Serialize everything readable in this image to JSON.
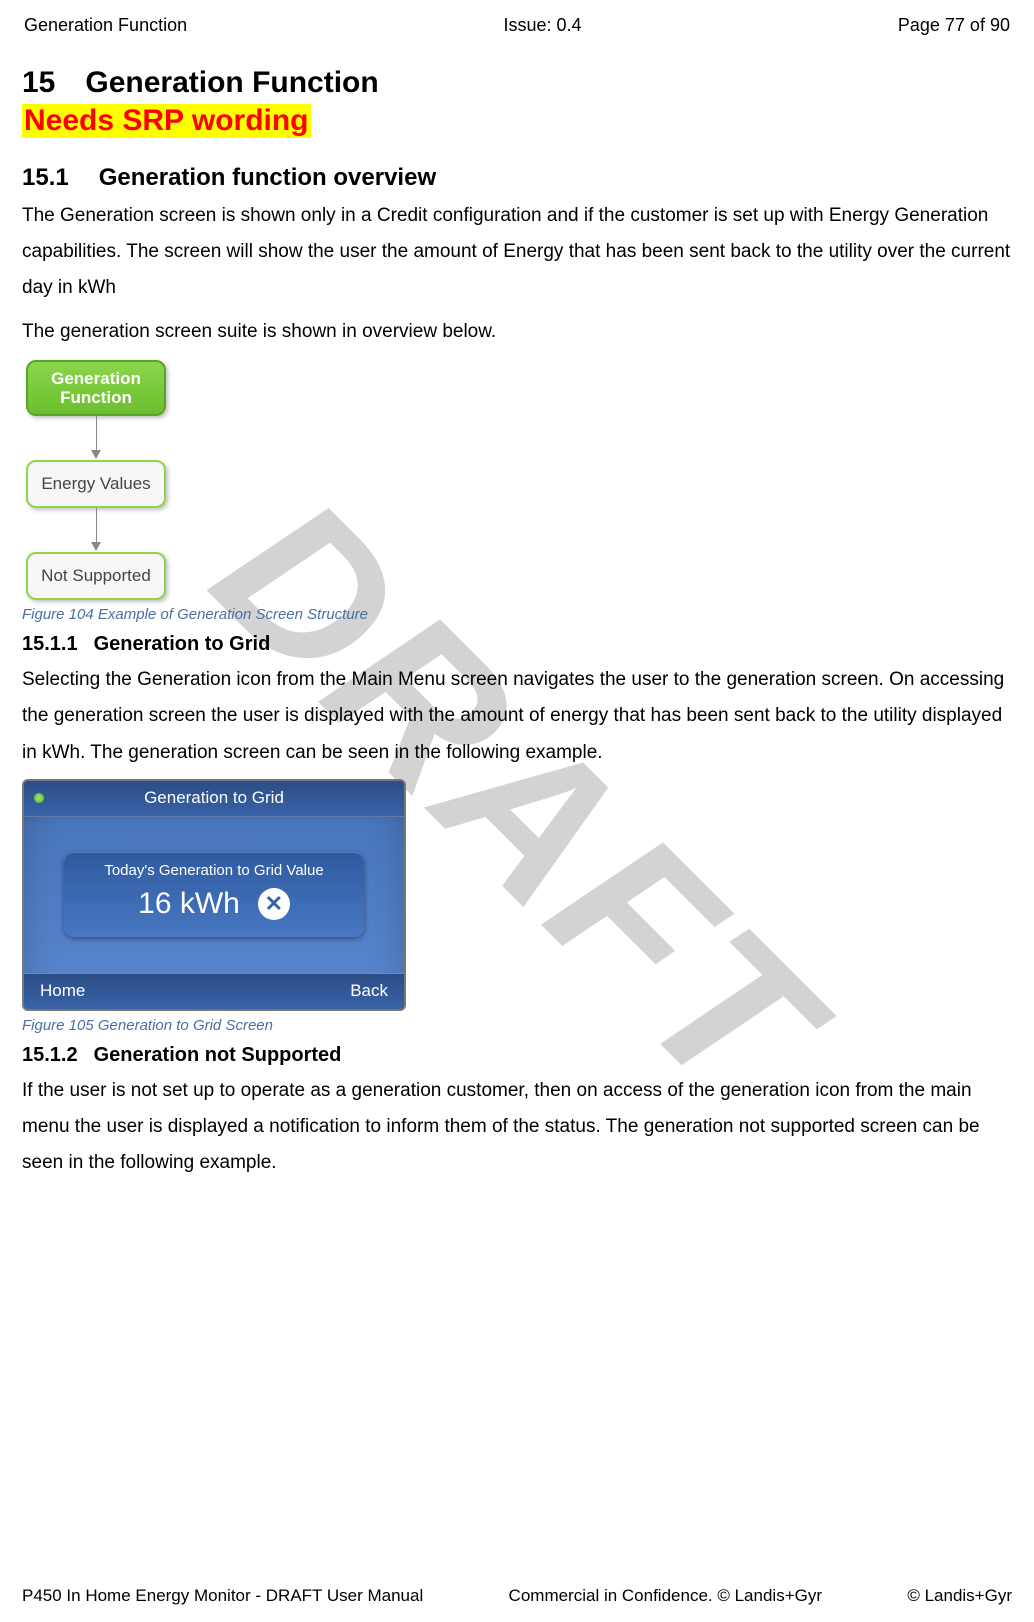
{
  "header": {
    "left": "Generation Function",
    "center": "Issue: 0.4",
    "right": "Page 77 of 90"
  },
  "watermark": "DRAFT",
  "section": {
    "number": "15",
    "title": "Generation Function",
    "highlight": "Needs SRP wording"
  },
  "sub1": {
    "number": "15.1",
    "title": "Generation function overview",
    "para1": "The Generation screen is shown only in a Credit configuration and if the customer is set up with Energy Generation capabilities. The screen will show the user the amount of Energy that has been sent back to the utility over the current day in kWh",
    "para2": "The generation screen suite is shown in overview below."
  },
  "flowchart": {
    "node1": "Generation Function",
    "node2": "Energy Values",
    "node3": "Not Supported"
  },
  "caption1": "Figure 104 Example of Generation Screen Structure",
  "sub11": {
    "number": "15.1.1",
    "title": "Generation to Grid",
    "para": "Selecting the Generation icon from the Main Menu screen navigates the user to the generation screen. On accessing the generation screen the user is displayed with the amount of energy that has been sent back to the utility displayed in kWh. The generation screen can be seen in the following example."
  },
  "device": {
    "title": "Generation to Grid",
    "panel_label": "Today's Generation to Grid Value",
    "value": "16 kWh",
    "check": "✕",
    "home": "Home",
    "back": "Back"
  },
  "caption2": "Figure 105 Generation to Grid Screen",
  "sub12": {
    "number": "15.1.2",
    "title": "Generation not Supported",
    "para": "If the user is not set up to operate as a generation customer, then on access of the generation icon from the main menu the user is displayed a notification to inform them of the status. The generation not supported screen can be seen in the following example."
  },
  "footer": {
    "left": "P450 In Home Energy Monitor - DRAFT User Manual",
    "center": "Commercial in Confidence. © Landis+Gyr",
    "right": "© Landis+Gyr"
  }
}
